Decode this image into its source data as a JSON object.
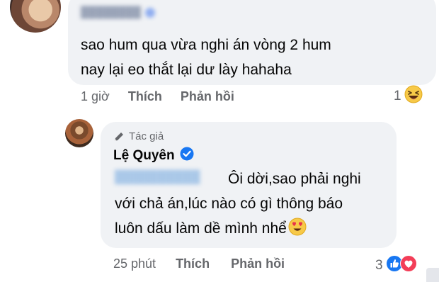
{
  "comment_1": {
    "text_lines": [
      "sao hum qua vừa nghi án vòng 2 hum",
      "nay lại eo thắt lại dư lày hahaha"
    ],
    "time": "1 giờ",
    "like_label": "Thích",
    "reply_label": "Phản hồi",
    "reaction_count": "1",
    "reaction_icon": "laughing-emoji-icon"
  },
  "reply_1": {
    "author_badge": "Tác giả",
    "author_name": "Lệ Quyên",
    "text_lines": [
      "Ôi dời,sao phải nghi",
      "với chả án,lúc nào có gì thông báo",
      "luôn dấu làm dề mình nhể"
    ],
    "time": "25 phút",
    "like_label": "Thích",
    "reply_label": "Phản hồi",
    "reaction_count": "3",
    "reaction_icons": [
      "like-icon",
      "heart-icon"
    ]
  },
  "colors": {
    "bubble_bg": "#f0f2f5",
    "meta_text": "#65676b",
    "verified_blue": "#1877f2",
    "heart_red": "#f33e58"
  }
}
